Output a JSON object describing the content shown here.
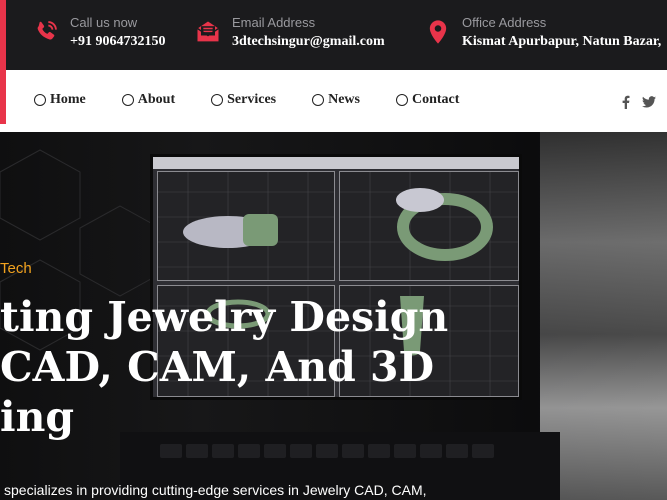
{
  "topbar": {
    "phone": {
      "label": "Call us now",
      "value": "+91 9064732150",
      "icon": "phone-icon"
    },
    "email": {
      "label": "Email Address",
      "value": "3dtechsingur@gmail.com",
      "icon": "envelope-icon"
    },
    "office": {
      "label": "Office Address",
      "value": "Kismat Apurbapur, Natun Bazar,",
      "icon": "map-pin-icon"
    },
    "accent_color": "#e8344a"
  },
  "nav": {
    "items": [
      {
        "label": "Home"
      },
      {
        "label": "About"
      },
      {
        "label": "Services"
      },
      {
        "label": "News"
      },
      {
        "label": "Contact"
      }
    ],
    "social": [
      "facebook-icon",
      "twitter-icon"
    ]
  },
  "hero": {
    "tag": "Tech",
    "headline_lines": [
      "ting Jewelry Design",
      "CAD, CAM, And 3D",
      "ing"
    ],
    "description": "specializes in providing cutting-edge services in Jewelry CAD, CAM,",
    "tag_color": "#f2a21e"
  }
}
